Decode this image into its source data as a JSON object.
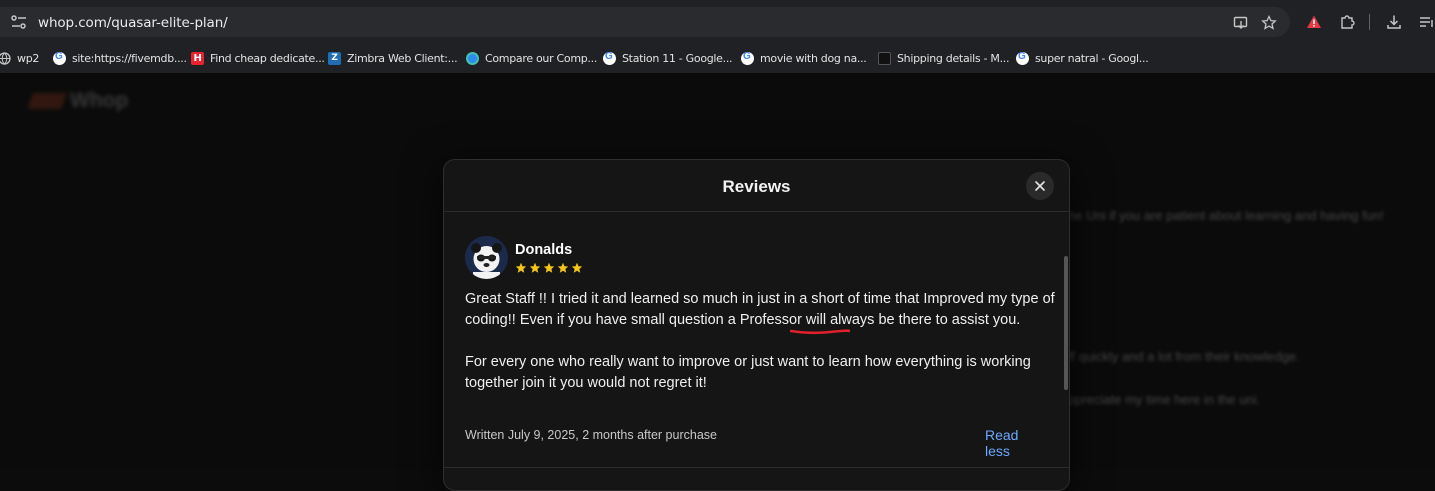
{
  "browser": {
    "url": "whop.com/quasar-elite-plan/",
    "bookmarks": [
      {
        "label": "wp2",
        "icon": "globe-icon"
      },
      {
        "label": "site:https://fivemdb....",
        "icon": "google-icon"
      },
      {
        "label": "Find cheap dedicate...",
        "icon": "h-site-icon"
      },
      {
        "label": "Zimbra Web Client:...",
        "icon": "zimbra-icon"
      },
      {
        "label": "Compare our Comp...",
        "icon": "compare-icon"
      },
      {
        "label": "Station 11 - Google...",
        "icon": "google-icon"
      },
      {
        "label": "movie with dog na...",
        "icon": "google-icon"
      },
      {
        "label": "Shipping details - M...",
        "icon": "shipping-icon"
      },
      {
        "label": "super natral - Googl...",
        "icon": "google-icon"
      }
    ]
  },
  "page": {
    "brand": "Whop",
    "background_snippets": [
      "he Uni if you are patient about learning and having fun!",
      "ff quickly and a lot from their knowledge.",
      "ppreciate my time here in the uni."
    ]
  },
  "modal": {
    "title": "Reviews",
    "review": {
      "author": "Donalds",
      "rating": 5,
      "paragraphs": [
        "Great Staff !! I tried it and learned so much in just in a short of time that Improved my type of coding!! Even if you have small question a Professor will always be there to assist you.",
        "For every one who really want to improve or just want to learn how everything is working together join it you would not regret it!"
      ],
      "meta": "Written July 9, 2025, 2 months after purchase",
      "toggle_label": "Read less"
    }
  },
  "colors": {
    "accent_link": "#6ea8ff",
    "star": "#f5c518",
    "brand": "#f35b2b",
    "annotation": "#e0202a"
  }
}
